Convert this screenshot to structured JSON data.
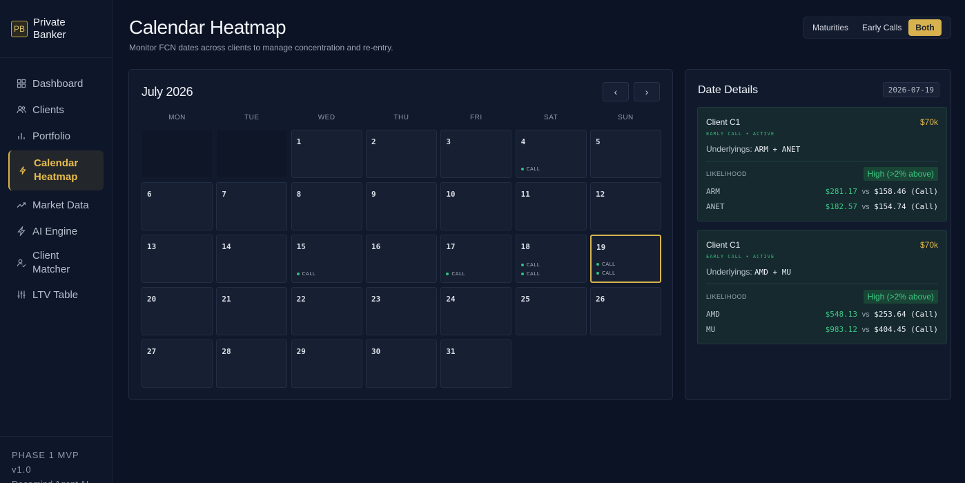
{
  "brand": {
    "logo": "PB",
    "name_line1": "Private",
    "name_line2": "Banker"
  },
  "nav": [
    {
      "label": "Dashboard",
      "icon": "dashboard-icon"
    },
    {
      "label": "Clients",
      "icon": "users-icon"
    },
    {
      "label": "Portfolio",
      "icon": "bar-chart-icon"
    },
    {
      "label_line1": "Calendar",
      "label_line2": "Heatmap",
      "icon": "lightning-icon",
      "active": true
    },
    {
      "label": "Market Data",
      "icon": "trend-icon"
    },
    {
      "label": "AI Engine",
      "icon": "bolt-icon"
    },
    {
      "label_line1": "Client",
      "label_line2": "Matcher",
      "icon": "user-match-icon"
    },
    {
      "label": "LTV Table",
      "icon": "sliders-icon"
    }
  ],
  "footer": {
    "version": "PHASE 1 MVP v1.0",
    "org": "Deepmind Agent AI"
  },
  "header": {
    "title": "Calendar Heatmap",
    "subtitle": "Monitor FCN dates across clients to manage concentration and re-entry."
  },
  "view_toggle": {
    "options": [
      "Maturities",
      "Early Calls",
      "Both"
    ],
    "selected": "Both"
  },
  "calendar": {
    "month_label": "July 2026",
    "prev": "‹",
    "next": "›",
    "weekdays": [
      "MON",
      "TUE",
      "WED",
      "THU",
      "FRI",
      "SAT",
      "SUN"
    ],
    "leading_empty": 2,
    "days": 31,
    "selected_day": 19,
    "events": {
      "4": [
        "CALL"
      ],
      "15": [
        "CALL"
      ],
      "17": [
        "CALL"
      ],
      "18": [
        "CALL",
        "CALL"
      ],
      "19": [
        "CALL",
        "CALL"
      ]
    }
  },
  "details": {
    "title": "Date Details",
    "date": "2026-07-19",
    "cards": [
      {
        "client": "Client C1",
        "amount": "$70k",
        "status": "EARLY CALL • ACTIVE",
        "underlyings_label": "Underlyings:",
        "underlyings": "ARM + ANET",
        "likelihood_label": "LIKELIHOOD",
        "likelihood": "High (>2% above)",
        "rows": [
          {
            "ticker": "ARM",
            "current": "$281.17",
            "vs": "vs",
            "ref": "$158.46 (Call)"
          },
          {
            "ticker": "ANET",
            "current": "$182.57",
            "vs": "vs",
            "ref": "$154.74 (Call)"
          }
        ]
      },
      {
        "client": "Client C1",
        "amount": "$70k",
        "status": "EARLY CALL • ACTIVE",
        "underlyings_label": "Underlyings:",
        "underlyings": "AMD + MU",
        "likelihood_label": "LIKELIHOOD",
        "likelihood": "High (>2% above)",
        "rows": [
          {
            "ticker": "AMD",
            "current": "$548.13",
            "vs": "vs",
            "ref": "$253.64 (Call)"
          },
          {
            "ticker": "MU",
            "current": "$983.12",
            "vs": "vs",
            "ref": "$404.45 (Call)"
          }
        ]
      }
    ]
  }
}
